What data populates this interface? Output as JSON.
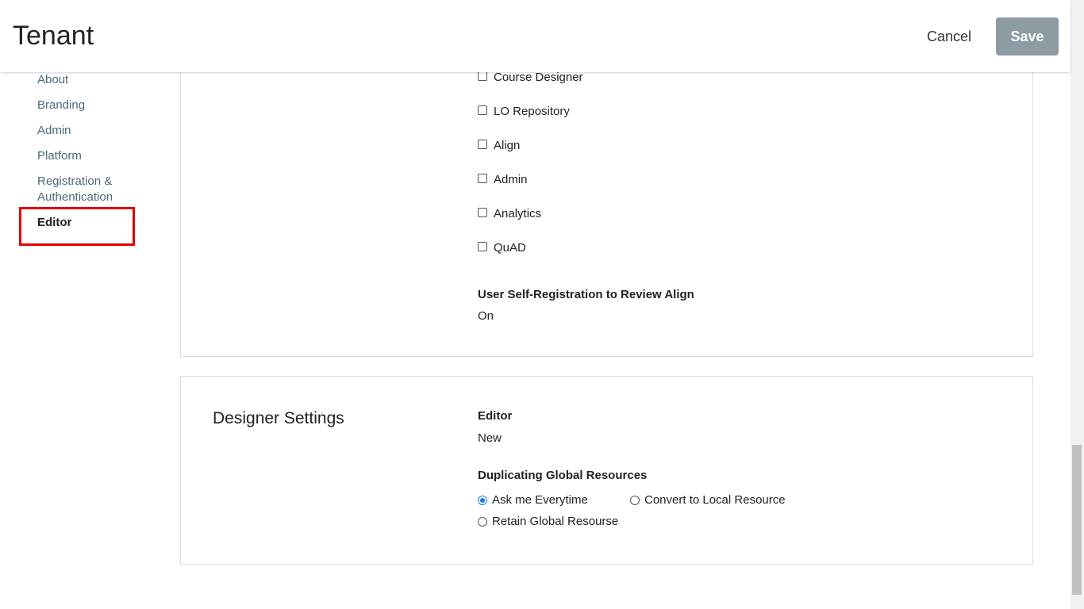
{
  "header": {
    "title": "Tenant",
    "cancel_label": "Cancel",
    "save_label": "Save"
  },
  "sidebar": {
    "items": [
      {
        "label": "About"
      },
      {
        "label": "Branding"
      },
      {
        "label": "Admin"
      },
      {
        "label": "Platform"
      },
      {
        "label": "Registration &"
      },
      {
        "label": "Authentication"
      },
      {
        "label": "Editor"
      }
    ],
    "active": "Editor",
    "highlight_color": "#e00000"
  },
  "apps": {
    "checkboxes": [
      {
        "label": "Course Designer",
        "checked": false
      },
      {
        "label": "LO Repository",
        "checked": false
      },
      {
        "label": "Align",
        "checked": false
      },
      {
        "label": "Admin",
        "checked": false
      },
      {
        "label": "Analytics",
        "checked": false
      },
      {
        "label": "QuAD",
        "checked": false
      }
    ],
    "self_registration_label": "User Self-Registration to Review Align",
    "self_registration_value": "On"
  },
  "designer": {
    "title": "Designer Settings",
    "editor_label": "Editor",
    "editor_value": "New",
    "duplicating_label": "Duplicating Global Resources",
    "options": [
      {
        "label": "Ask me Everytime",
        "checked": true
      },
      {
        "label": "Convert to Local Resource",
        "checked": false
      },
      {
        "label": "Retain Global Resourse",
        "checked": false
      }
    ]
  },
  "colors": {
    "save_bg": "#8d9ba3",
    "link": "#4a6a7a",
    "radio_accent": "#1a73e8"
  }
}
